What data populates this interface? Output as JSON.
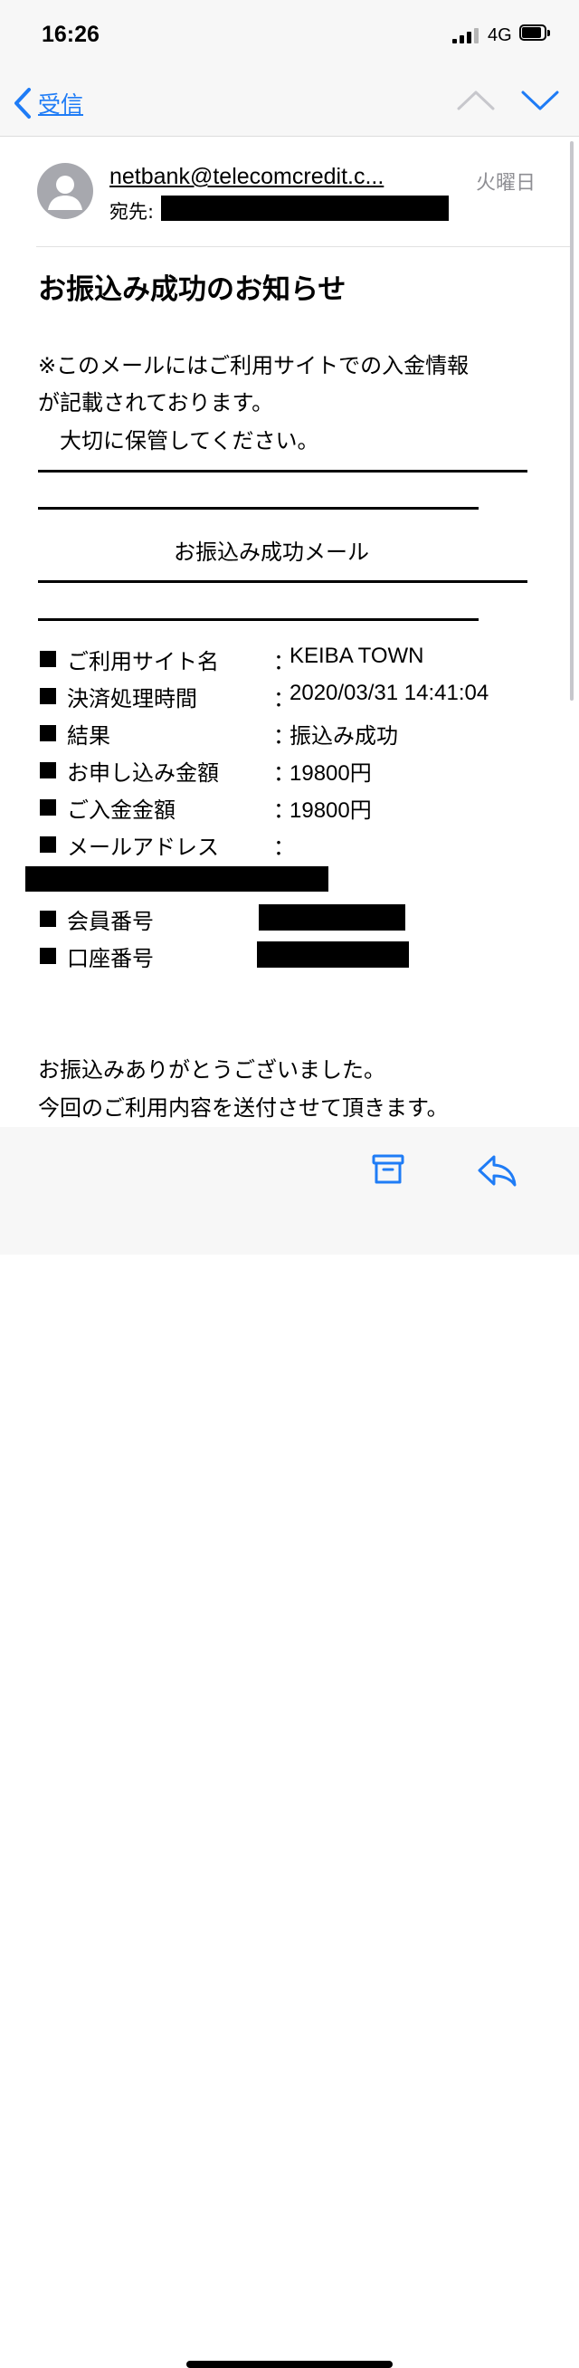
{
  "status_bar": {
    "time": "16:26",
    "network": "4G"
  },
  "nav": {
    "back_label": "受信"
  },
  "header": {
    "sender": "netbank@telecomcredit.c...",
    "date": "火曜日",
    "to_label": "宛先:"
  },
  "subject": "お振込み成功のお知らせ",
  "body": {
    "intro_line1": "※このメールにはご利用サイトでの入金情報",
    "intro_line2": "が記載されております。",
    "intro_line3": "　大切に保管してください。",
    "center_title": "お振込み成功メール",
    "rows": [
      {
        "label": "ご利用サイト名",
        "colon": "：",
        "value": "KEIBA TOWN"
      },
      {
        "label": "決済処理時間",
        "colon": "：",
        "value": "2020/03/31 14:41:04"
      },
      {
        "label": "結果",
        "colon": "：",
        "value": "振込み成功"
      },
      {
        "label": "お申し込み金額",
        "colon": "：",
        "value": "19800円"
      },
      {
        "label": "ご入金金額",
        "colon": "：",
        "value": "19800円"
      },
      {
        "label": "メールアドレス",
        "colon": "：",
        "value": ""
      },
      {
        "label": "会員番号",
        "colon": "",
        "value": ""
      },
      {
        "label": "口座番号",
        "colon": "",
        "value": ""
      }
    ],
    "closing_line1": "お振込みありがとうございました。",
    "closing_line2": "今回のご利用内容を送付させて頂きます。"
  },
  "icons": {
    "back": "chevron-left-icon",
    "prev": "chevron-up-icon",
    "next": "chevron-down-icon",
    "archive": "archive-icon",
    "reply": "reply-icon",
    "avatar": "person-icon"
  },
  "colors": {
    "accent": "#1f7cf6",
    "disabled": "#c7c7cc",
    "muted": "#8e8e93"
  }
}
